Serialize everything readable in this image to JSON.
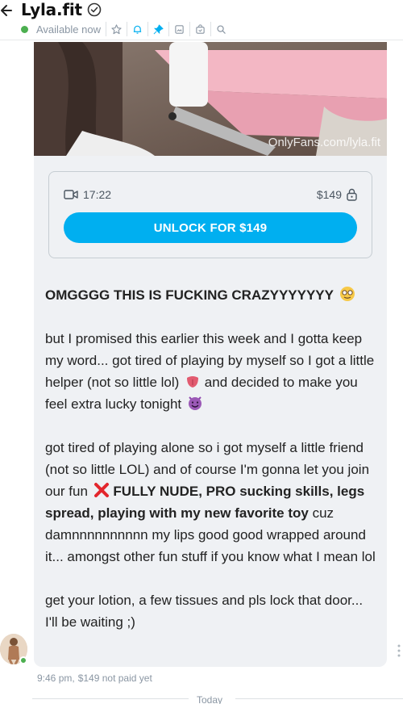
{
  "header": {
    "title": "Lyla.fit",
    "status": "Available now",
    "icons": [
      "back-arrow-icon",
      "verified-icon",
      "star-icon",
      "bell-icon",
      "pin-icon",
      "gallery-icon",
      "tip-icon",
      "search-icon"
    ]
  },
  "message": {
    "preview_watermark": "OnlyFans.com/lyla.fit",
    "media_duration": "17:22",
    "price": "$149",
    "unlock_label": "UNLOCK FOR $149",
    "heading": "OMGGGG THIS IS FUCKING CRAZYYYYYYY",
    "para1_a": "but I promised this earlier this week and I gotta keep my word... got tired of playing by myself so I got a little helper (not so little lol)",
    "para1_b": "and decided to make you feel extra lucky tonight",
    "para2_a": "got tired of playing alone so i got myself a little friend (not so little LOL) and of course I'm gonna let you join our fun",
    "para2_bold": "FULLY NUDE, PRO sucking skills, legs spread, playing with my new favorite toy",
    "para2_b": "cuz damnnnnnnnnnn my lips good good wrapped around it... amongst other fun stuff if you know what I mean lol",
    "para3": "get your lotion, a few tissues and pls lock that door... I'll be waiting ;)",
    "time": "9:46 pm,",
    "paid_status": "$149 not paid yet"
  },
  "divider": {
    "label": "Today"
  },
  "colors": {
    "accent": "#00aff0",
    "online": "#4caf50",
    "bubble": "#eff1f4",
    "muted": "#8a96a3"
  }
}
